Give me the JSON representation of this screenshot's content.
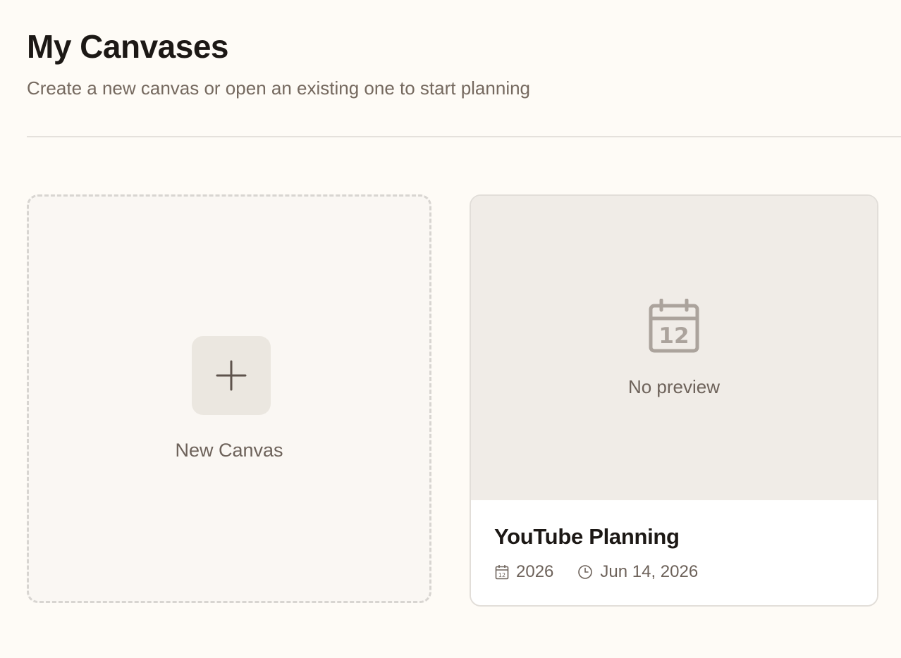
{
  "header": {
    "title": "My Canvases",
    "subtitle": "Create a new canvas or open an existing one to start planning"
  },
  "new_canvas": {
    "label": "New Canvas",
    "icon": "plus-icon"
  },
  "canvases": [
    {
      "title": "YouTube Planning",
      "preview_text": "No preview",
      "preview_icon": "calendar-icon",
      "preview_icon_number": "12",
      "year": "2026",
      "updated": "Jun 14, 2026"
    }
  ],
  "colors": {
    "background": "#fefbf6",
    "text_primary": "#1c1815",
    "text_secondary": "#75695f",
    "preview_background": "#f0ece7"
  }
}
